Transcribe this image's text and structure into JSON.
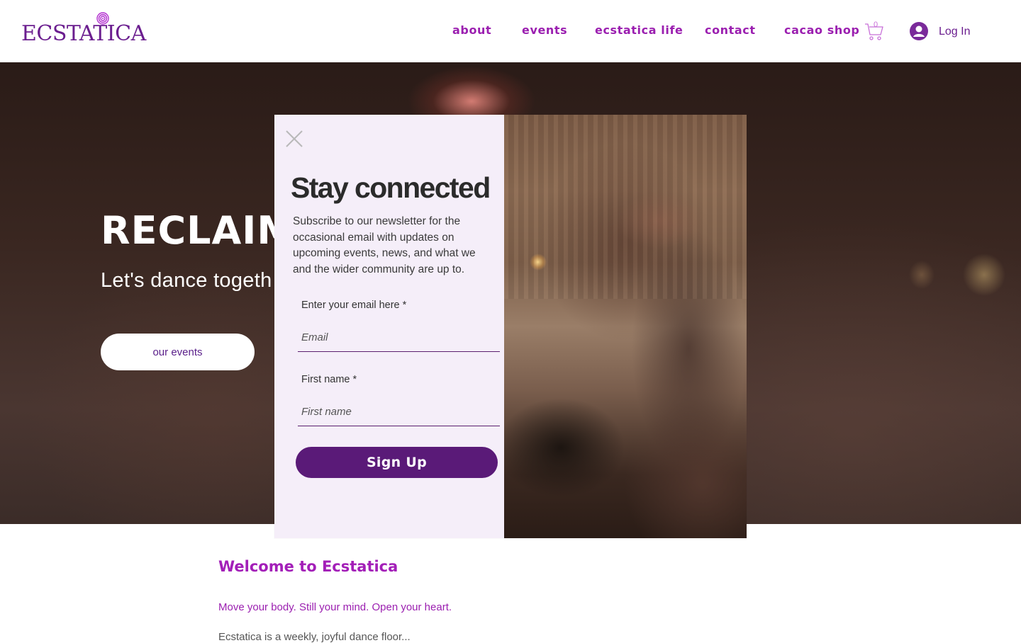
{
  "header": {
    "logo_text": "ECSTATICA",
    "nav": [
      {
        "label": "about"
      },
      {
        "label": "events"
      },
      {
        "label": "ecstatica life"
      },
      {
        "label": "contact"
      },
      {
        "label": "cacao shop"
      }
    ],
    "cart_count": "0",
    "login_label": "Log In"
  },
  "hero": {
    "title": "RECLAIM",
    "subtitle": "Let's dance togeth",
    "button_label": "our events"
  },
  "content": {
    "welcome_heading": "Welcome to Ecstatica",
    "tagline": "Move your body. Still your mind. Open your heart.",
    "body": "Ecstatica is a weekly, joyful dance floor..."
  },
  "modal": {
    "title": "Stay connected",
    "description": "Subscribe to our newsletter for the occasional email with updates on upcoming events, news, and what we and the wider community are up to.",
    "email_label": "Enter your email here *",
    "email_placeholder": "Email",
    "firstname_label": "First name *",
    "firstname_placeholder": "First name",
    "signup_label": "Sign Up"
  },
  "colors": {
    "brand_purple": "#6b1e8f",
    "nav_purple": "#9b1fb0",
    "button_purple": "#5a1a78",
    "modal_bg": "#f5eef9"
  },
  "icons": {
    "cart": "shopping-cart-icon",
    "avatar": "user-avatar-icon",
    "close": "close-icon",
    "logo_mark": "spiral-icon"
  }
}
